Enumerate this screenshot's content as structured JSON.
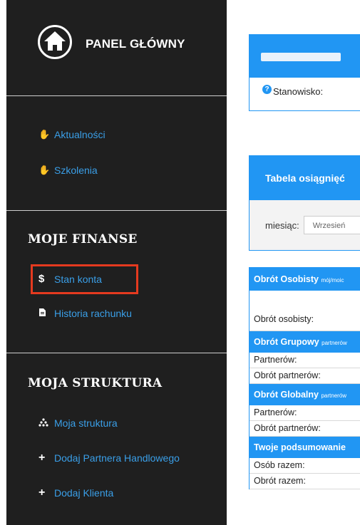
{
  "sidebar": {
    "logo_text": "PANEL GŁÓWNY",
    "nav_top": [
      {
        "label": "Aktualności",
        "icon": "handshake-icon"
      },
      {
        "label": "Szkolenia",
        "icon": "handshake-icon"
      }
    ],
    "finanse": {
      "title": "MOJE FINANSE",
      "items": [
        {
          "label": "Stan konta",
          "icon": "dollar-icon"
        },
        {
          "label": "Historia rachunku",
          "icon": "document-icon"
        }
      ]
    },
    "struktura": {
      "title": "MOJA STRUKTURA",
      "items": [
        {
          "label": "Moja struktura",
          "icon": "hierarchy-icon"
        },
        {
          "label": "Dodaj Partnera Handlowego",
          "icon": "plus-icon"
        },
        {
          "label": "Dodaj Klienta",
          "icon": "plus-icon"
        }
      ]
    }
  },
  "main": {
    "card1": {
      "field_label": "Stanowisko:"
    },
    "card2": {
      "title": "Tabela osiągnięć",
      "month_label": "miesiąc:",
      "month_value": "Wrzesień"
    },
    "table": {
      "osobisty": {
        "title": "Obrót Osobisty",
        "sub": "mój/moic",
        "rows": [
          "Obrót osobisty:"
        ]
      },
      "grupowy": {
        "title": "Obrót Grupowy",
        "sub": "partnerów",
        "rows": [
          "Partnerów:",
          "Obrót partnerów:"
        ]
      },
      "globalny": {
        "title": "Obrót Globalny",
        "sub": "partnerów",
        "rows": [
          "Partnerów:",
          "Obrót partnerów:"
        ]
      },
      "podsumowanie": {
        "title": "Twoje podsumowanie",
        "rows": [
          "Osób razem:",
          "Obrót razem:"
        ]
      }
    }
  },
  "colors": {
    "sidebar_bg": "#1f1f1f",
    "accent": "#2196f3",
    "link": "#3a9fe8",
    "highlight": "#e53a1f"
  }
}
